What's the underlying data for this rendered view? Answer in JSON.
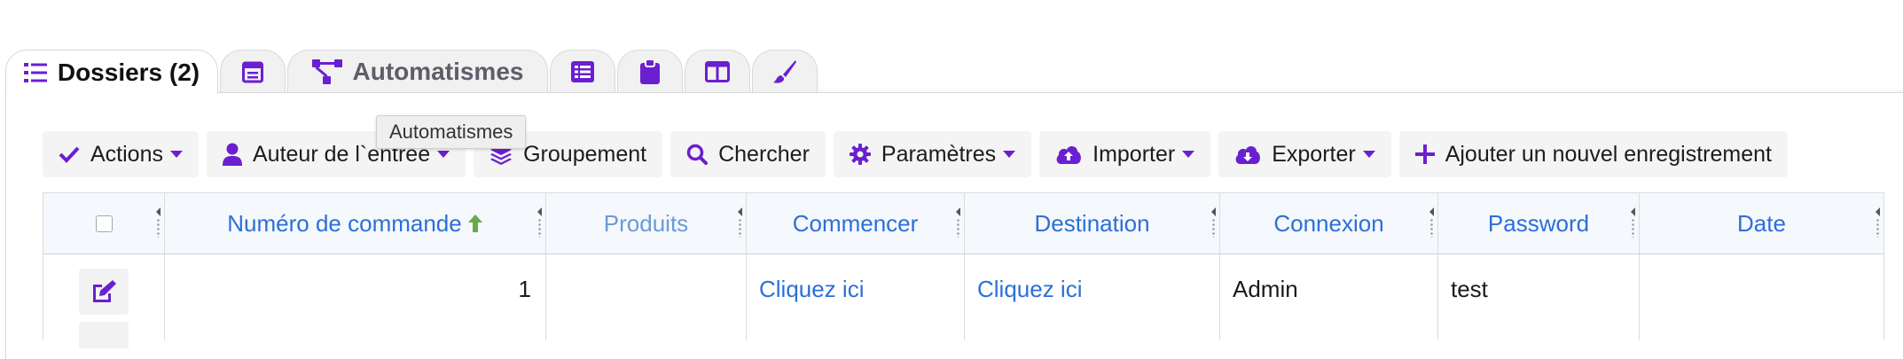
{
  "tabs": [
    {
      "label": "Dossiers (2)",
      "icon": "list-icon",
      "active": true
    },
    {
      "label": "",
      "icon": "calendar-icon",
      "active": false
    },
    {
      "label": "Automatismes",
      "icon": "workflow-icon",
      "active": false
    },
    {
      "label": "",
      "icon": "table-list-icon",
      "active": false
    },
    {
      "label": "",
      "icon": "clipboard-icon",
      "active": false
    },
    {
      "label": "",
      "icon": "columns-icon",
      "active": false
    },
    {
      "label": "",
      "icon": "paintbrush-icon",
      "active": false
    }
  ],
  "tooltip": {
    "text": "Automatismes"
  },
  "toolbar": {
    "actions": "Actions",
    "author": "Auteur de l`entrée",
    "grouping": "Groupement",
    "search": "Chercher",
    "settings": "Paramètres",
    "import": "Importer",
    "export": "Exporter",
    "add": "Ajouter un nouvel enregistrement"
  },
  "table": {
    "columns": [
      "Numéro de commande",
      "Produits",
      "Commencer",
      "Destination",
      "Connexion",
      "Password",
      "Date"
    ],
    "sorted_column": "Numéro de commande",
    "rows": [
      {
        "num": "1",
        "products": "",
        "start": "Cliquez ici",
        "destination": "Cliquez ici",
        "login": "Admin",
        "password": "test",
        "date": ""
      }
    ]
  },
  "colors": {
    "accent": "#6a1fd0",
    "link": "#2c6fd8",
    "sort_arrow": "#6aa84f"
  }
}
